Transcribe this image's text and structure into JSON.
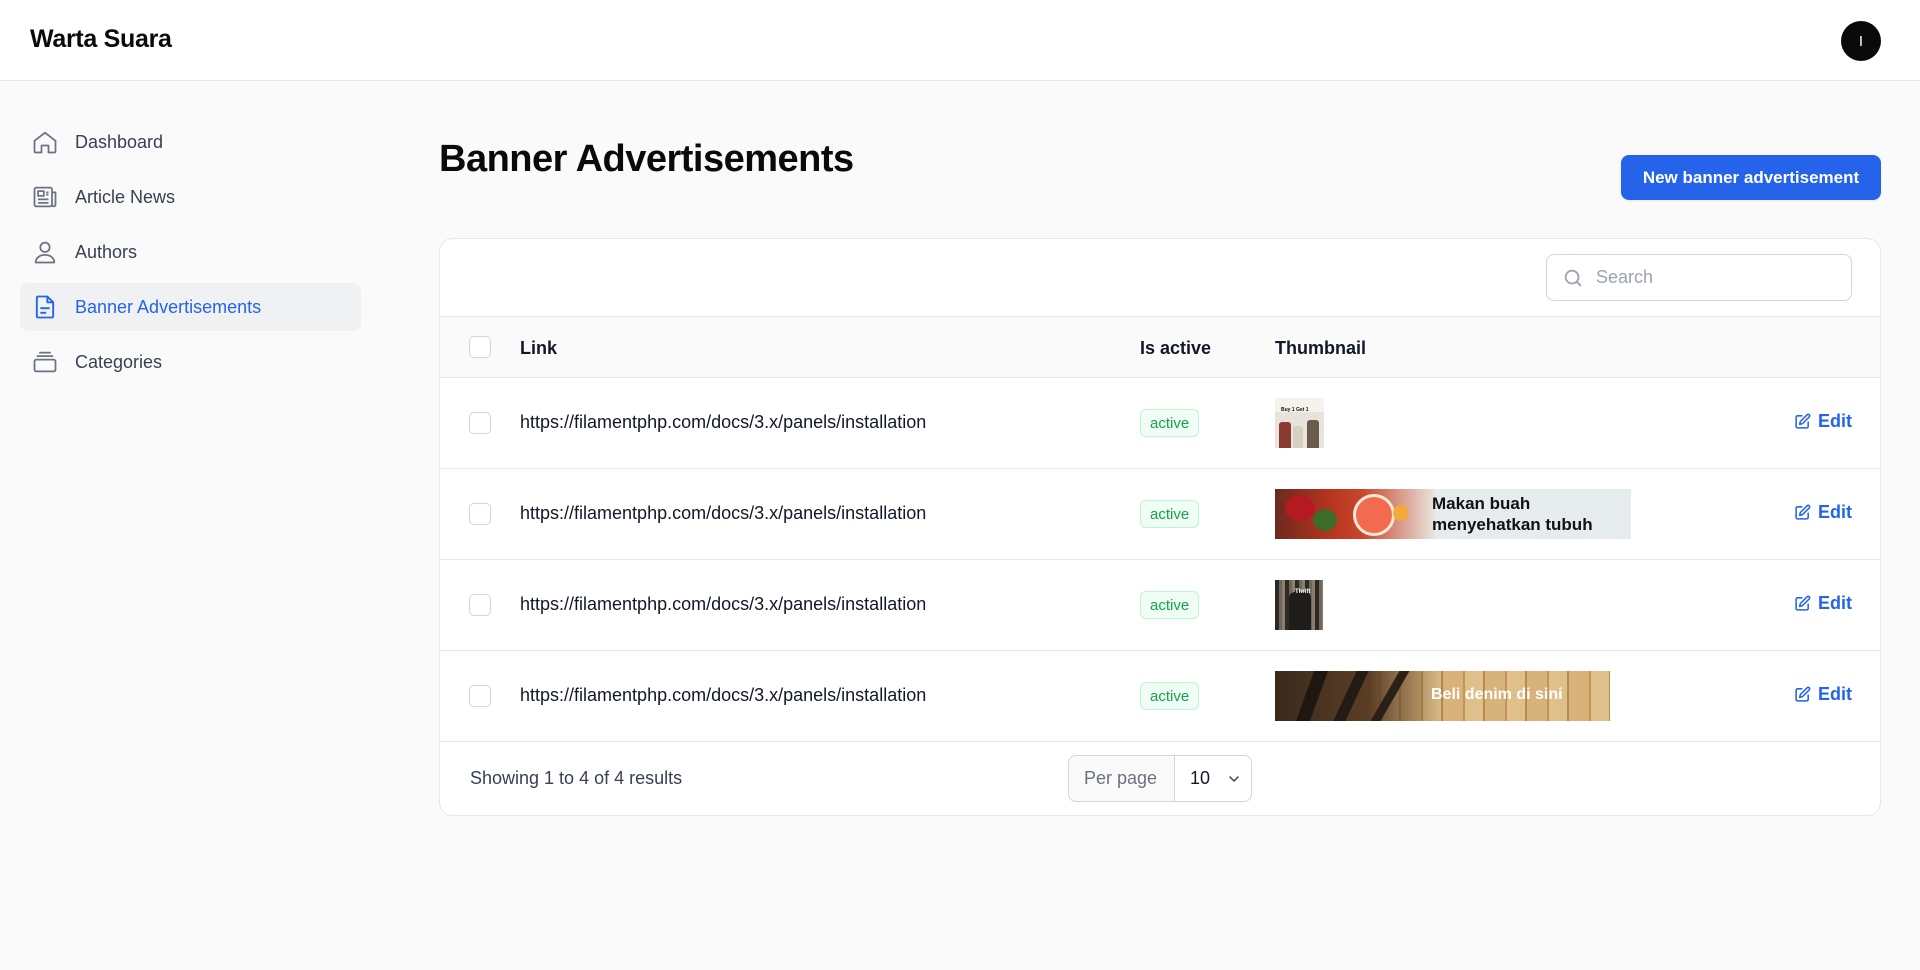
{
  "app": {
    "brand": "Warta Suara",
    "avatar_initial": "I"
  },
  "sidebar": {
    "items": [
      {
        "label": "Dashboard",
        "icon": "home-icon",
        "active": false
      },
      {
        "label": "Article News",
        "icon": "newspaper-icon",
        "active": false
      },
      {
        "label": "Authors",
        "icon": "user-icon",
        "active": false
      },
      {
        "label": "Banner Advertisements",
        "icon": "document-icon",
        "active": true
      },
      {
        "label": "Categories",
        "icon": "stack-icon",
        "active": false
      }
    ]
  },
  "page": {
    "title": "Banner Advertisements",
    "new_button_label": "New banner advertisement"
  },
  "search": {
    "placeholder": "Search",
    "value": ""
  },
  "table": {
    "columns": {
      "link": "Link",
      "is_active": "Is active",
      "thumbnail": "Thumbnail"
    },
    "rows": [
      {
        "link": "https://filamentphp.com/docs/3.x/panels/installation",
        "status": "active",
        "thumbnail_text": "Buy 1 Get 1",
        "edit_label": "Edit"
      },
      {
        "link": "https://filamentphp.com/docs/3.x/panels/installation",
        "status": "active",
        "thumbnail_text_1": "Makan buah",
        "thumbnail_text_2": "menyehatkan tubuh",
        "edit_label": "Edit"
      },
      {
        "link": "https://filamentphp.com/docs/3.x/panels/installation",
        "status": "active",
        "thumbnail_text": "Thrift",
        "edit_label": "Edit"
      },
      {
        "link": "https://filamentphp.com/docs/3.x/panels/installation",
        "status": "active",
        "thumbnail_text": "Beli denim di sini",
        "edit_label": "Edit"
      }
    ]
  },
  "pagination": {
    "summary": "Showing 1 to 4 of 4 results",
    "per_page_label": "Per page",
    "per_page_value": "10"
  },
  "colors": {
    "primary": "#2563eb",
    "badge_text": "#16a34a",
    "badge_bg": "#f0fdf4"
  }
}
